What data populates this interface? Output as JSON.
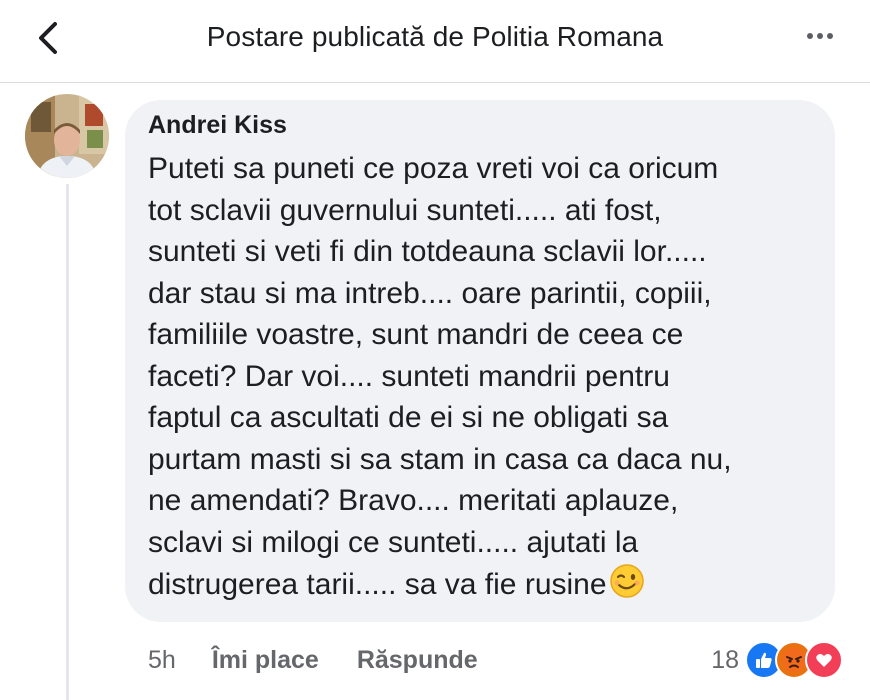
{
  "header": {
    "title": "Postare publicată de Politia Romana",
    "back_icon": "chevron-left-icon",
    "more_icon": "more-horizontal-icon"
  },
  "comment": {
    "author": "Andrei Kiss",
    "lines": [
      "Puteti sa puneti ce poza vreti voi ca oricum",
      "tot sclavii guvernului sunteti..... ati fost,",
      "sunteti si veti fi din totdeauna sclavii lor.....",
      "dar stau si ma intreb.... oare parintii, copiii,",
      "familiile voastre, sunt mandri de ceea ce",
      "faceti? Dar voi.... sunteti mandrii pentru",
      "faptul ca ascultati de ei si ne obligati sa",
      "purtam masti si sa stam in casa ca daca nu,",
      "ne amendati? Bravo.... meritati aplauze,",
      "sclavi si milogi ce sunteti..... ajutati la",
      "distrugerea tarii..... sa va fie rusine"
    ],
    "emoji": "winking-face-emoji",
    "time": "5h",
    "like_label": "Îmi place",
    "reply_label": "Răspunde",
    "reaction_count": "18",
    "reactions": [
      "like",
      "angry",
      "love"
    ]
  },
  "colors": {
    "bubble": "#f0f2f5",
    "secondary_text": "#65676b",
    "like_blue": "#1877f2",
    "angry_orange": "#e9710f",
    "love_red": "#f33e58"
  }
}
